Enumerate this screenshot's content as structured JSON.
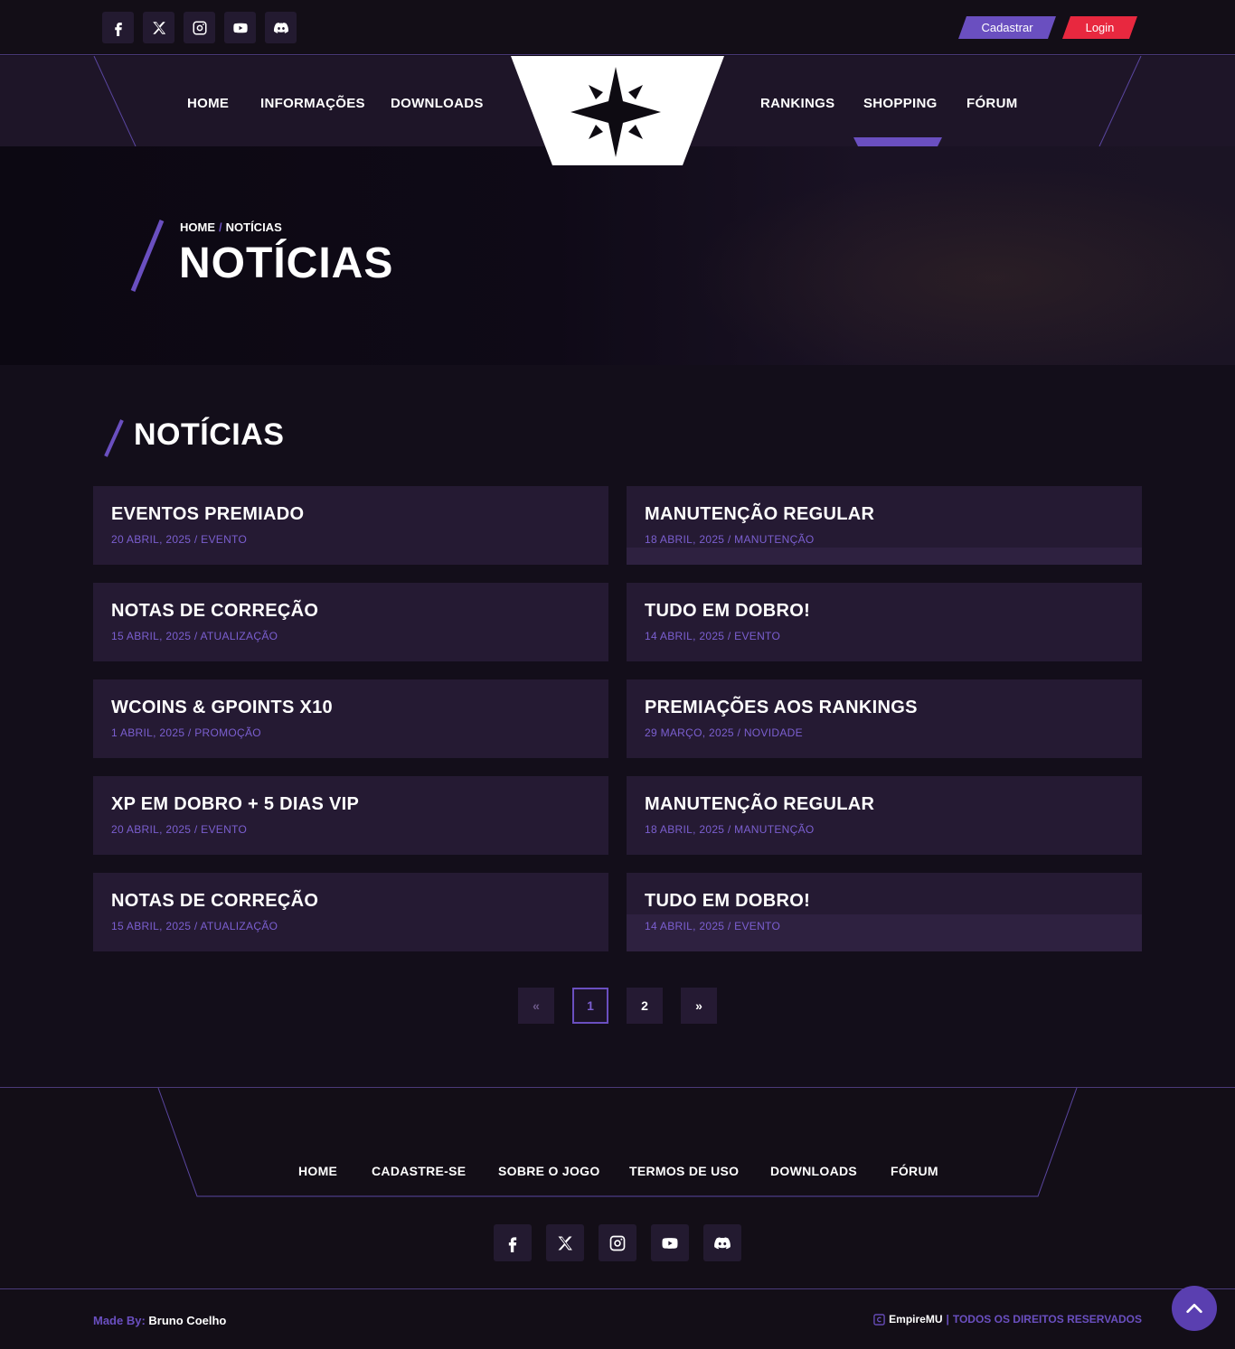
{
  "header": {
    "socials": [
      "facebook-icon",
      "x-icon",
      "instagram-icon",
      "youtube-icon",
      "discord-icon"
    ],
    "register_label": "Cadastrar",
    "login_label": "Login"
  },
  "nav": {
    "left": [
      "HOME",
      "INFORMAÇÕES",
      "DOWNLOADS"
    ],
    "right": [
      "RANKINGS",
      "SHOPPING",
      "FÓRUM"
    ],
    "active": "SHOPPING"
  },
  "hero": {
    "breadcrumb_home": "HOME",
    "breadcrumb_sep": "/",
    "breadcrumb_current": "NOTÍCIAS",
    "title": "NOTÍCIAS"
  },
  "section": {
    "title": "NOTÍCIAS"
  },
  "news": [
    {
      "title": "EVENTOS PREMIADO",
      "meta": "20 ABRIL, 2025 / EVENTO"
    },
    {
      "title": "MANUTENÇÃO REGULAR",
      "meta": "18 ABRIL, 2025 / MANUTENÇÃO"
    },
    {
      "title": "NOTAS DE CORREÇÃO",
      "meta": "15 ABRIL, 2025 / ATUALIZAÇÃO"
    },
    {
      "title": "TUDO EM DOBRO!",
      "meta": "14 ABRIL, 2025 / EVENTO"
    },
    {
      "title": "WCOINS & GPOINTS X10",
      "meta": "1 ABRIL, 2025 / PROMOÇÃO"
    },
    {
      "title": "PREMIAÇÕES AOS RANKINGS",
      "meta": "29 MARÇO, 2025 / NOVIDADE"
    },
    {
      "title": "XP EM DOBRO + 5 DIAS VIP",
      "meta": "20 ABRIL, 2025 / EVENTO"
    },
    {
      "title": "MANUTENÇÃO REGULAR",
      "meta": "18 ABRIL, 2025 / MANUTENÇÃO"
    },
    {
      "title": "NOTAS DE CORREÇÃO",
      "meta": "15 ABRIL, 2025 / ATUALIZAÇÃO"
    },
    {
      "title": "TUDO EM DOBRO!",
      "meta": "14 ABRIL, 2025 / EVENTO"
    }
  ],
  "pagination": {
    "prev": "«",
    "pages": [
      "1",
      "2"
    ],
    "current": "1",
    "next": "»"
  },
  "footer": {
    "links": [
      "HOME",
      "CADASTRE-SE",
      "SOBRE O JOGO",
      "TERMOS DE USO",
      "DOWNLOADS",
      "FÓRUM"
    ],
    "made_by_label": "Made By:",
    "made_by_name": "Bruno Coelho",
    "brand": "EmpireMU",
    "divider": "|",
    "rights": "TODOS OS DIREITOS RESERVADOS"
  },
  "colors": {
    "accent": "#6a4fc0",
    "login": "#e8283f",
    "card": "#251a33",
    "background": "#130e1a"
  }
}
